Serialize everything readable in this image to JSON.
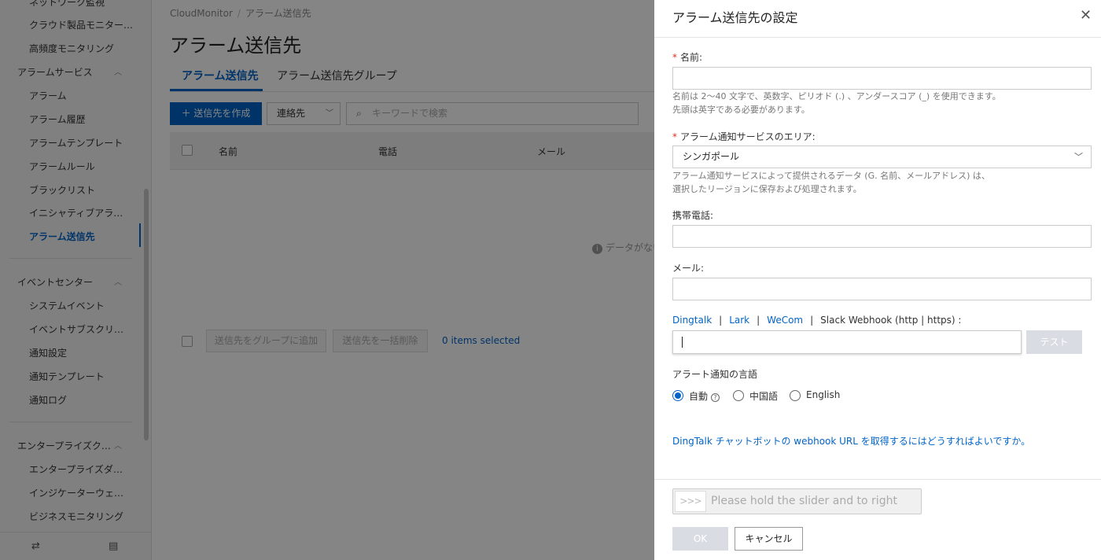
{
  "sidebar": {
    "items": [
      {
        "label": "ネットワーク監視",
        "group": false
      },
      {
        "label": "クラウド製品モニター…",
        "group": false
      },
      {
        "label": "高頻度モニタリング",
        "group": false
      },
      {
        "label": "アラームサービス",
        "group": true
      },
      {
        "label": "アラーム",
        "group": false
      },
      {
        "label": "アラーム履歴",
        "group": false
      },
      {
        "label": "アラームテンプレート",
        "group": false
      },
      {
        "label": "アラームルール",
        "group": false
      },
      {
        "label": "ブラックリスト",
        "group": false
      },
      {
        "label": "イニシャティブアラ…",
        "group": false
      },
      {
        "label": "アラーム送信先",
        "group": false,
        "active": true
      },
      {
        "label": "イベントセンター",
        "group": true
      },
      {
        "label": "システムイベント",
        "group": false
      },
      {
        "label": "イベントサブスクリ…",
        "group": false
      },
      {
        "label": "通知設定",
        "group": false
      },
      {
        "label": "通知テンプレート",
        "group": false
      },
      {
        "label": "通知ログ",
        "group": false
      },
      {
        "label": "エンタープライズク…",
        "group": true
      },
      {
        "label": "エンタープライズダ…",
        "group": false
      },
      {
        "label": "インジケーターウェ…",
        "group": false
      },
      {
        "label": "ビジネスモニタリング",
        "group": false
      }
    ],
    "bottom_icons": [
      "swap-icon",
      "message-icon"
    ]
  },
  "main": {
    "breadcrumb": [
      "CloudMonitor",
      "アラーム送信先"
    ],
    "title": "アラーム送信先",
    "tabs": [
      {
        "label": "アラーム送信先",
        "active": true
      },
      {
        "label": "アラーム送信先グループ",
        "active": false
      }
    ],
    "create_button": "＋ 送信先を作成",
    "contact_select": "連絡先",
    "search_placeholder": "キーワードで検索",
    "table_columns": [
      "名前",
      "電話",
      "メール"
    ],
    "empty_text": "データがない",
    "add_to_group_button": "送信先をグループに追加",
    "bulk_delete_button": "送信先を一括削除",
    "selected_count": "0 items selected"
  },
  "drawer": {
    "title": "アラーム送信先の設定",
    "name": {
      "label": "名前:",
      "value": "",
      "help_line1": "名前は 2～40 文字で、英数字、ピリオド (.) 、アンダースコア (_) を使用できます。",
      "help_line2": "先頭は英字である必要があります。"
    },
    "area": {
      "label": "アラーム通知サービスのエリア:",
      "value": "シンガポール",
      "help_line1": "アラーム通知サービスによって提供されるデータ (G. 名前、メールアドレス) は、",
      "help_line2": "選択したリージョンに保存および処理されます。"
    },
    "phone": {
      "label": "携帯電話:",
      "value": ""
    },
    "email": {
      "label": "メール:",
      "value": ""
    },
    "webhook": {
      "links": [
        "Dingtalk",
        "Lark",
        "WeCom"
      ],
      "separator": "|",
      "tail": "Slack Webhook (http | https) :",
      "value": "",
      "test_button": "テスト"
    },
    "language": {
      "label": "アラート通知の言語",
      "options": [
        {
          "label": "自動",
          "selected": true
        },
        {
          "label": "中国語",
          "selected": false
        },
        {
          "label": "English",
          "selected": false
        }
      ]
    },
    "dingtalk_help_link": "DingTalk チャットボットの webhook URL を取得するにはどうすればよいですか。",
    "slider": {
      "handle": ">>>",
      "text": "Please hold the slider and to right"
    },
    "ok_button": "OK",
    "cancel_button": "キャンセル"
  },
  "colors": {
    "accent": "#0064c8",
    "required": "#d93026",
    "overlay": "rgba(0,0,0,0.48)"
  }
}
